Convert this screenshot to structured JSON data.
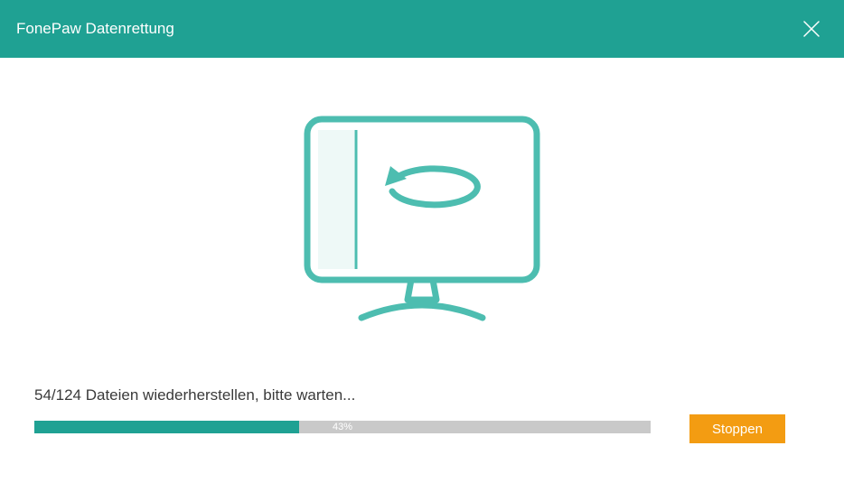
{
  "header": {
    "title": "FonePaw Datenrettung"
  },
  "progress": {
    "status_text": "54/124 Dateien wiederherstellen, bitte warten...",
    "percent_label": "43%",
    "percent_value": 43
  },
  "buttons": {
    "stop_label": "Stoppen"
  },
  "colors": {
    "teal": "#1fa193",
    "orange": "#f39c12",
    "gray": "#c9c9c9"
  }
}
